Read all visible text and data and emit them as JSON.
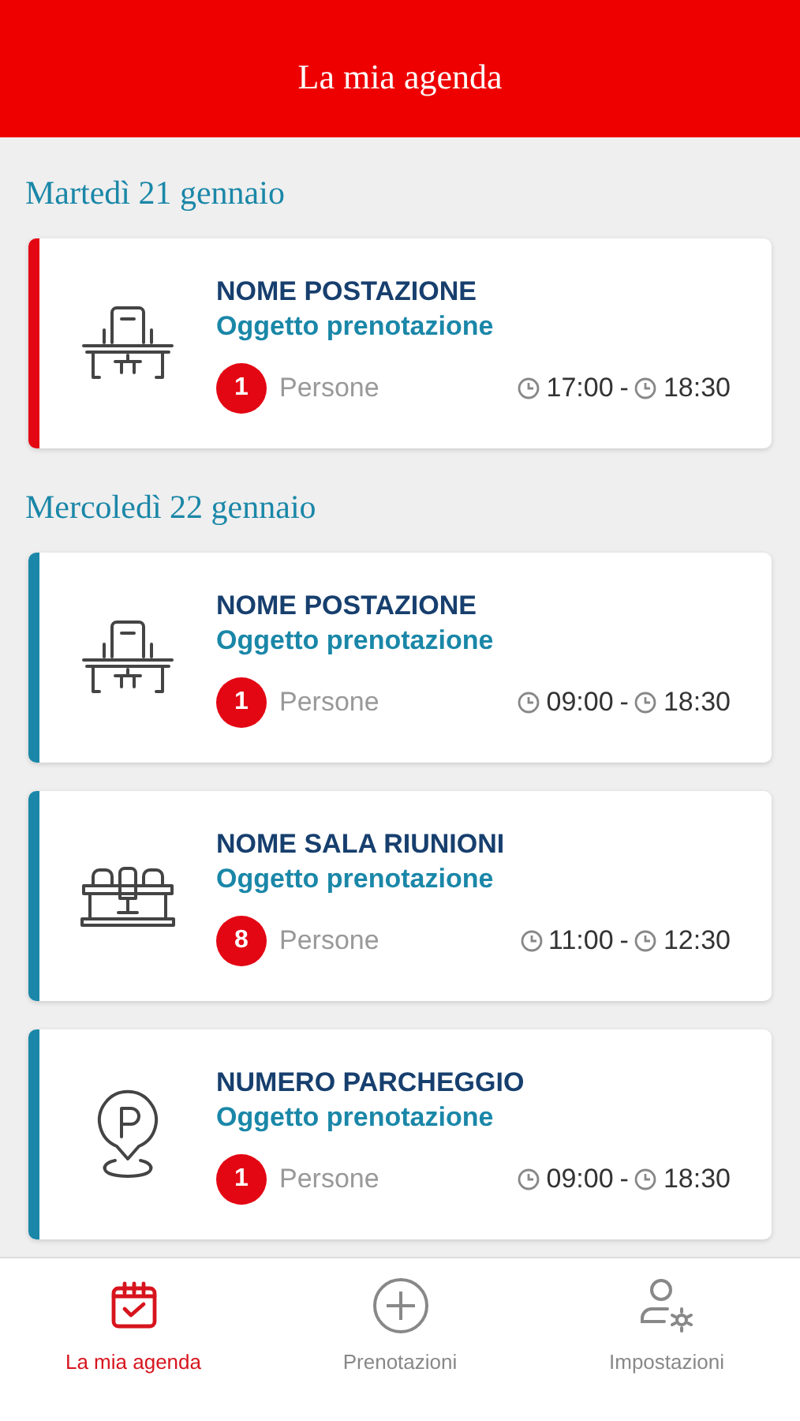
{
  "header": {
    "title": "La mia agenda"
  },
  "days": [
    {
      "title": "Martedì 21 gennaio",
      "bookings": [
        {
          "kind": "desk",
          "color": "#e30613",
          "name": "NOME POSTAZIONE",
          "subject": "Oggetto prenotazione",
          "count": "1",
          "people_label": "Persone",
          "start": "17:00",
          "separator": "-",
          "end": "18:30"
        }
      ]
    },
    {
      "title": "Mercoledì 22 gennaio",
      "bookings": [
        {
          "kind": "desk",
          "color": "#1a87a8",
          "name": "NOME POSTAZIONE",
          "subject": "Oggetto prenotazione",
          "count": "1",
          "people_label": "Persone",
          "start": "09:00",
          "separator": "-",
          "end": "18:30"
        },
        {
          "kind": "meeting",
          "color": "#1a87a8",
          "name": "NOME SALA RIUNIONI",
          "subject": "Oggetto prenotazione",
          "count": "8",
          "people_label": "Persone",
          "start": "11:00",
          "separator": "-",
          "end": "12:30"
        },
        {
          "kind": "parking",
          "color": "#1a87a8",
          "name": "NUMERO PARCHEGGIO",
          "subject": "Oggetto prenotazione",
          "count": "1",
          "people_label": "Persone",
          "start": "09:00",
          "separator": "-",
          "end": "18:30"
        }
      ]
    }
  ],
  "nav": [
    {
      "kind": "agenda",
      "label": "La mia agenda",
      "selected": true
    },
    {
      "kind": "add",
      "label": "Prenotazioni",
      "selected": false
    },
    {
      "kind": "settings",
      "label": "Impostazioni",
      "selected": false
    }
  ]
}
